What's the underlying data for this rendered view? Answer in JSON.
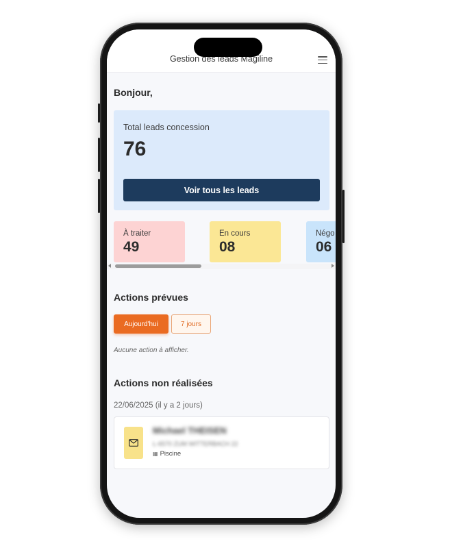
{
  "header": {
    "title": "Gestion des leads Magiline"
  },
  "greeting": "Bonjour,",
  "total": {
    "label": "Total leads concession",
    "value": "76",
    "button_label": "Voir tous les leads",
    "background": "#dceafb",
    "button_color": "#1d3b5d"
  },
  "stats": [
    {
      "label": "À traiter",
      "value": "49",
      "color": "#fdd3d3"
    },
    {
      "label": "En cours",
      "value": "08",
      "color": "#fbe795"
    },
    {
      "label": "Négo",
      "value": "06",
      "color": "#c9e4fb"
    }
  ],
  "planned": {
    "title": "Actions prévues",
    "filters": [
      {
        "label": "Aujourd'hui",
        "active": true
      },
      {
        "label": "7 jours",
        "active": false
      }
    ],
    "empty_message": "Aucune action à afficher."
  },
  "unrealized": {
    "title": "Actions non réalisées",
    "date_label": "22/06/2025 (il y a 2 jours)",
    "items": [
      {
        "icon": "mail-icon",
        "name": "Michael THEISEN",
        "address": "L-6570 ZUM WITTERBACH 22",
        "category": "Piscine",
        "badge_color": "#f8e28a"
      }
    ]
  },
  "accent_color": "#ea6b22"
}
